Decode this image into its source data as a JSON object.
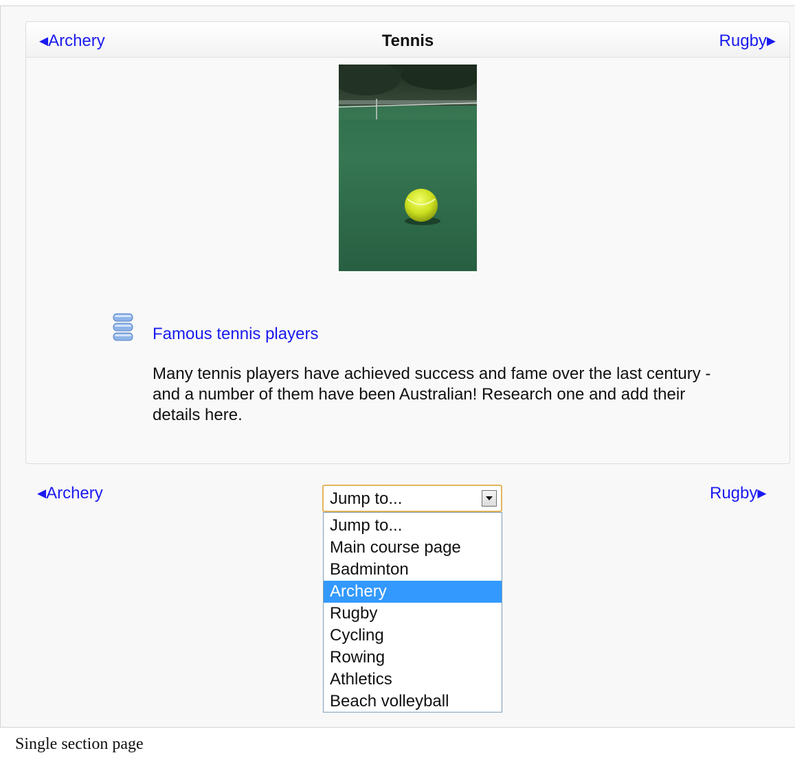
{
  "section": {
    "title": "Tennis",
    "prev_label": "Archery",
    "next_label": "Rugby",
    "prev_arrow": "◀",
    "next_arrow": "▶"
  },
  "photo": {
    "icon": "tennis-ball-photo"
  },
  "activity": {
    "icon": "database-icon",
    "link": "Famous tennis players",
    "description": "Many tennis players have achieved success and fame over the last century - and a number of them have been Australian!  Research one and add their details here."
  },
  "footer_nav": {
    "prev_label": "Archery",
    "next_label": "Rugby",
    "prev_arrow": "◀",
    "next_arrow": "▶"
  },
  "jump_select": {
    "value": "Jump to...",
    "options": [
      "Jump to...",
      "Main course page",
      "Badminton",
      "Archery",
      "Rugby",
      "Cycling",
      "Rowing",
      "Athletics",
      "Beach volleyball"
    ],
    "highlighted": "Archery"
  },
  "colors": {
    "link": "#1a1af0",
    "highlight": "#3399ff",
    "focus_border": "#e3b45a"
  },
  "caption": "Single section page"
}
